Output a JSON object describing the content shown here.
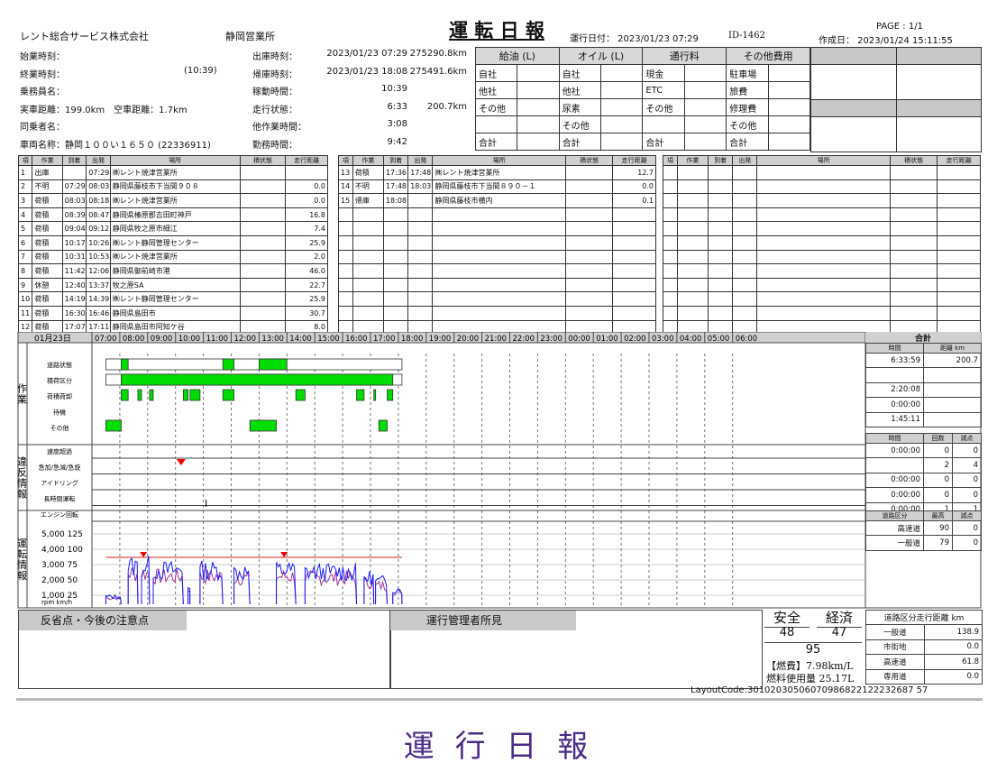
{
  "header": {
    "company": "レント総合サービス株式会社",
    "office": "静岡営業所",
    "title": "運 転 日 報",
    "run_date": "運行日付： 2023/01/23 07:29",
    "id": "ID-1462",
    "created": "作成日： 2023/01/24 15:11:55",
    "page": "PAGE : 1/1"
  },
  "info": {
    "labels": [
      "始業時刻：",
      "終業時刻：",
      "乗務員名：",
      "実車距離：199.0km　空車距離：1.7km",
      "同乗者名：",
      "車両名称：静岡１００い１６５０ (22336911)"
    ],
    "end_extra": "(10:39)",
    "times": [
      {
        "label": "出庫時刻：",
        "value": "2023/01/23 07:29",
        "extra": "275290.8km"
      },
      {
        "label": "帰庫時刻：",
        "value": "2023/01/23 18:08",
        "extra": "275491.6km"
      },
      {
        "label": "稼動時間：",
        "value": "10:39",
        "extra": ""
      },
      {
        "label": "走行状態：",
        "value": "6:33",
        "extra": "200.7km"
      },
      {
        "label": "他作業時間：",
        "value": "3:08",
        "extra": ""
      },
      {
        "label": "勤務時間：",
        "value": "9:42",
        "extra": ""
      }
    ]
  },
  "fees": {
    "headers": [
      "給油 (L)",
      "オイル (L)",
      "通行料",
      "その他費用"
    ],
    "rows": [
      [
        "自社",
        "",
        "自社",
        "",
        "現金",
        "",
        "駐車場",
        ""
      ],
      [
        "他社",
        "",
        "他社",
        "",
        "ETC",
        "",
        "旅費",
        ""
      ],
      [
        "その他",
        "",
        "尿素",
        "",
        "その他",
        "",
        "修理費",
        ""
      ],
      [
        "",
        "",
        "その他",
        "",
        "",
        "",
        "その他",
        ""
      ],
      [
        "合計",
        "",
        "合計",
        "",
        "合計",
        "",
        "合計",
        ""
      ]
    ]
  },
  "work": {
    "headers": [
      "項",
      "作業",
      "到着",
      "出発",
      "場所",
      "積状態",
      "走行距離"
    ],
    "left": [
      [
        "1",
        "出庫",
        "",
        "07:29",
        "㈱レント焼津営業所",
        "",
        ""
      ],
      [
        "2",
        "不明",
        "07:29",
        "08:03",
        "静岡県藤枝市下当間９０８",
        "",
        "0.0"
      ],
      [
        "3",
        "荷積",
        "08:03",
        "08:18",
        "㈱レント焼津営業所",
        "",
        "0.0"
      ],
      [
        "4",
        "荷積",
        "08:39",
        "08:47",
        "静岡県榛原郡吉田町神戸",
        "",
        "16.8"
      ],
      [
        "5",
        "荷積",
        "09:04",
        "09:12",
        "静岡県牧之原市細江",
        "",
        "7.4"
      ],
      [
        "6",
        "荷積",
        "10:17",
        "10:26",
        "㈱レント静岡管理センター",
        "",
        "25.9"
      ],
      [
        "7",
        "荷積",
        "10:31",
        "10:53",
        "㈱レント焼津営業所",
        "",
        "2.0"
      ],
      [
        "8",
        "荷積",
        "11:42",
        "12:06",
        "静岡県御前崎市港",
        "",
        "46.0"
      ],
      [
        "9",
        "休憩",
        "12:40",
        "13:37",
        "牧之原SA",
        "",
        "22.7"
      ],
      [
        "10",
        "荷積",
        "14:19",
        "14:39",
        "㈱レント静岡管理センター",
        "",
        "25.9"
      ],
      [
        "11",
        "荷積",
        "16:30",
        "16:46",
        "静岡県島田市",
        "",
        "30.7"
      ],
      [
        "12",
        "荷積",
        "17:07",
        "17:11",
        "静岡県島田市阿知ケ谷",
        "",
        "8.0"
      ]
    ],
    "mid": [
      [
        "13",
        "荷積",
        "17:36",
        "17:48",
        "㈱レント焼津営業所",
        "",
        "12.7"
      ],
      [
        "14",
        "不明",
        "17:48",
        "18:03",
        "静岡県藤枝市下当間８９０－１",
        "",
        "0.0"
      ],
      [
        "15",
        "帰庫",
        "18:08",
        "",
        "静岡県藤枝市横内",
        "",
        "0.1"
      ]
    ]
  },
  "timeline": {
    "date": "01月23日",
    "hours": [
      "07:00",
      "08:00",
      "09:00",
      "10:00",
      "11:00",
      "12:00",
      "13:00",
      "14:00",
      "15:00",
      "16:00",
      "17:00",
      "18:00",
      "19:00",
      "20:00",
      "21:00",
      "22:00",
      "23:00",
      "00:00",
      "01:00",
      "02:00",
      "03:00",
      "04:00",
      "05:00",
      "06:00"
    ],
    "sections": [
      {
        "name": "作業",
        "rows": [
          "道路状態",
          "積荷区分",
          "荷積荷卸",
          "待機",
          "その他"
        ]
      },
      {
        "name": "違反情報",
        "rows": [
          "速度超過",
          "急加/急減/急旋",
          "アイドリング",
          "長時間運転",
          "エンジン回転"
        ]
      },
      {
        "name": "運転情報",
        "rows": []
      }
    ],
    "y_labels": [
      "5,000 125",
      "4,000 100",
      "3,000 75",
      "2,000 50",
      "1,000 25",
      "rpm km/h"
    ],
    "colors": {
      "activity": "#00dd00",
      "speed": "#1a1aff",
      "rpm": "#993399",
      "limit": "#cc2222",
      "marker": "#ee0000"
    }
  },
  "summary": {
    "title": "合計",
    "h1": [
      "時間",
      "距離 km"
    ],
    "work_rows": [
      [
        "6:33:59",
        "200.7"
      ],
      [
        "",
        ""
      ],
      [
        "2:20:08",
        ""
      ],
      [
        "0:00:00",
        ""
      ],
      [
        "1:45:11",
        ""
      ]
    ],
    "h2": [
      "時間",
      "回数",
      "減点"
    ],
    "vio_rows": [
      [
        "0:00:00",
        "0",
        "0"
      ],
      [
        "",
        "2",
        "4"
      ],
      [
        "0:00:00",
        "0",
        "0"
      ],
      [
        "0:00:00",
        "0",
        "0"
      ],
      [
        "0:00:00",
        "1",
        "1"
      ]
    ],
    "h3": [
      "道路区分",
      "最高",
      "減点"
    ],
    "road_rows": [
      [
        "高速道",
        "90",
        "0"
      ],
      [
        "一般道",
        "79",
        "0"
      ]
    ]
  },
  "bottom": {
    "notes_label": "反省点・今後の注意点",
    "manager_label": "運行管理者所見",
    "safety_label": "安全",
    "eco_label": "経済",
    "safety_score": "48",
    "eco_score": "47",
    "total_score": "95",
    "fuel_eff": "【燃費】7.98km/L",
    "fuel_used": "燃料使用量 25.17L",
    "road_title": "道路区分走行距離 km",
    "road_dist": [
      [
        "一般道",
        "138.9"
      ],
      [
        "市街地",
        "0.0"
      ],
      [
        "高速道",
        "61.8"
      ],
      [
        "専用道",
        "0.0"
      ]
    ],
    "layout_code": "LayoutCode:30102030506070986822122232687 57"
  },
  "caption": "運 行 日 報"
}
